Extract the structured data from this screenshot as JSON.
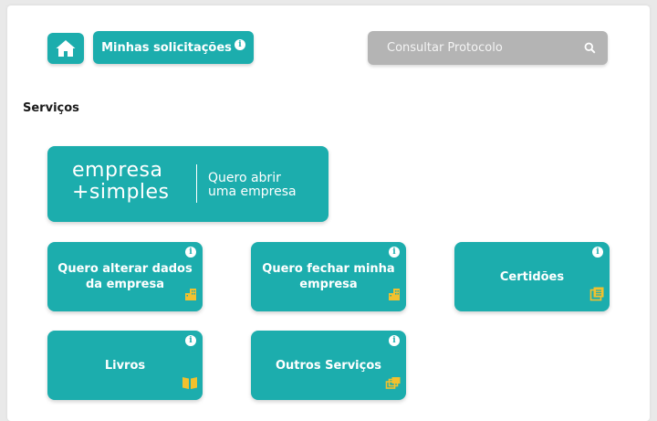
{
  "colors": {
    "accent": "#1cadad",
    "search_bg": "#b4b4b4",
    "icon_yellow": "#f2c12e"
  },
  "header": {
    "home_icon": "home-icon",
    "requests_label": "Minhas solicitações",
    "search_placeholder": "Consultar Protocolo",
    "search_icon": "search-icon"
  },
  "services": {
    "title": "Serviços",
    "hero": {
      "brand_line1": "empresa",
      "brand_line2": "+simples",
      "text_line1": "Quero abrir",
      "text_line2": "uma empresa"
    },
    "cards": [
      {
        "label": "Quero alterar dados da empresa",
        "icon": "building-icon"
      },
      {
        "label": "Quero fechar minha empresa",
        "icon": "building-icon"
      },
      {
        "label": "Certidões",
        "icon": "documents-icon"
      },
      {
        "label": "Livros",
        "icon": "open-book-icon"
      },
      {
        "label": "Outros Serviços",
        "icon": "layers-icon"
      }
    ]
  }
}
